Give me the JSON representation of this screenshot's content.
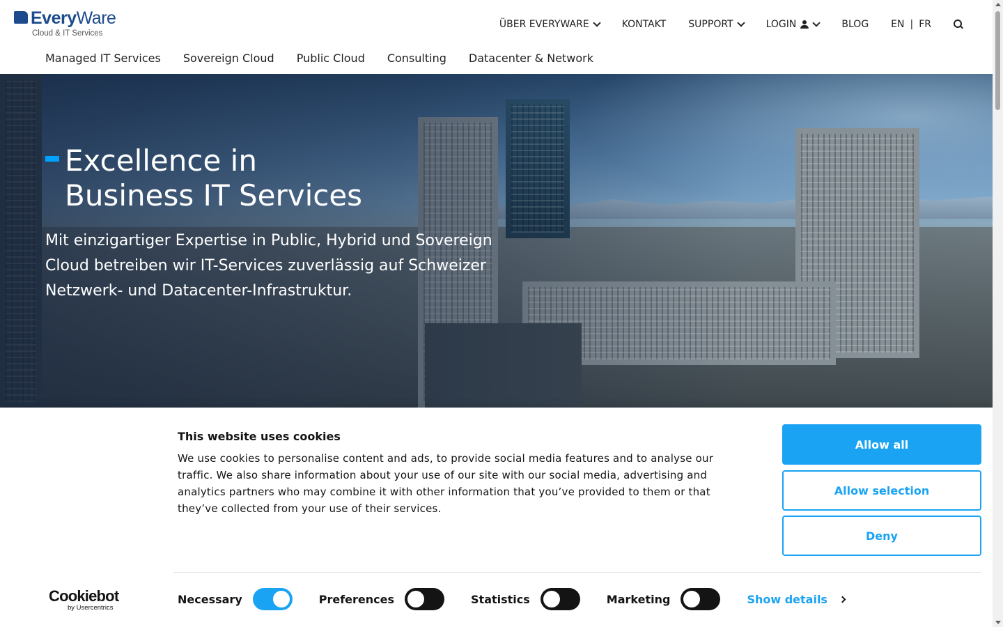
{
  "brand": {
    "name_part1": "Every",
    "name_part2": "Ware",
    "tagline": "Cloud & IT Services"
  },
  "topnav": {
    "about": "ÜBER EVERYWARE",
    "contact": "KONTAKT",
    "support": "SUPPORT",
    "login": "LOGIN",
    "blog": "BLOG",
    "lang_en": "EN",
    "lang_sep": "|",
    "lang_fr": "FR"
  },
  "mainnav": [
    "Managed IT Services",
    "Sovereign Cloud",
    "Public Cloud",
    "Consulting",
    "Datacenter & Network"
  ],
  "hero": {
    "title_line1": "Excellence in",
    "title_line2": "Business IT Services",
    "text": "Mit einzigartiger Expertise in Public, Hybrid und Sovereign Cloud betreiben wir IT-Services zuverlässig auf Schweizer Netzwerk- und Datacenter-Infrastruktur."
  },
  "cookie": {
    "title": "This website uses cookies",
    "text": "We use cookies to personalise content and ads, to provide social media features and to analyse our traffic. We also share information about your use of our site with our social media, advertising and analytics partners who may combine it with other information that you’ve provided to them or that they’ve collected from your use of their services.",
    "allow_all": "Allow all",
    "allow_selection": "Allow selection",
    "deny": "Deny",
    "toggles": {
      "necessary": {
        "label": "Necessary",
        "on": true
      },
      "preferences": {
        "label": "Preferences",
        "on": false
      },
      "statistics": {
        "label": "Statistics",
        "on": false
      },
      "marketing": {
        "label": "Marketing",
        "on": false
      }
    },
    "show_details": "Show details",
    "provider_logo": "Cookiebot",
    "provider_sub": "by Usercentrics"
  },
  "colors": {
    "brand_blue": "#1c4a8c",
    "accent_blue": "#1aa3f3",
    "hero_accent": "#00a2ff"
  }
}
